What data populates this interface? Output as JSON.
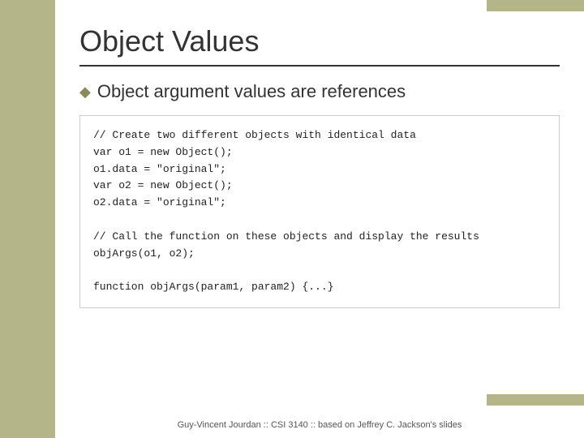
{
  "decorative": {
    "left_bar_color": "#b5b58a",
    "top_right_bar_color": "#b5b58a",
    "bottom_right_bar_color": "#b5b58a"
  },
  "slide": {
    "title": "Object Values",
    "bullet": "Object argument values are references",
    "diamond_char": "◆",
    "code": "// Create two different objects with identical data\nvar o1 = new Object();\no1.data = \"original\";\nvar o2 = new Object();\no2.data = \"original\";\n\n// Call the function on these objects and display the results\nobjArgs(o1, o2);\n\nfunction objArgs(param1, param2) {...}"
  },
  "footer": {
    "text": "Guy-Vincent Jourdan :: CSI 3140 :: based on Jeffrey C. Jackson's slides"
  }
}
